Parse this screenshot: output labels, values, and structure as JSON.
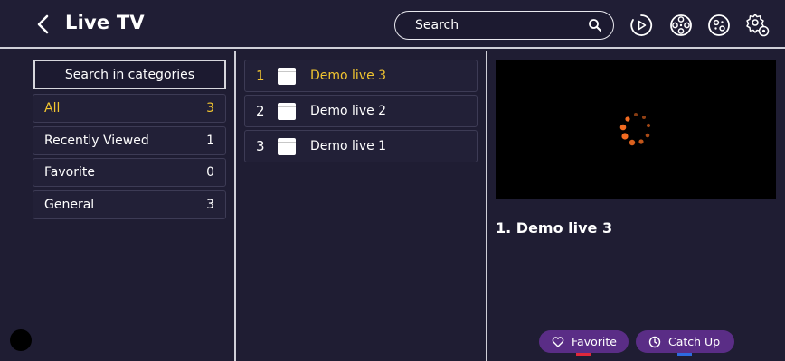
{
  "header": {
    "title": "Live TV",
    "search_placeholder": "Search",
    "icons": [
      "back-arrow-icon",
      "search-icon",
      "play-circle-icon",
      "film-reel-icon",
      "gamepad-icon",
      "settings-icon"
    ]
  },
  "categories": {
    "search_label": "Search in categories",
    "items": [
      {
        "label": "All",
        "count": "3",
        "active": true
      },
      {
        "label": "Recently Viewed",
        "count": "1",
        "active": false
      },
      {
        "label": "Favorite",
        "count": "0",
        "active": false
      },
      {
        "label": "General",
        "count": "3",
        "active": false
      }
    ]
  },
  "channels": [
    {
      "num": "1",
      "name": "Demo live 3",
      "active": true
    },
    {
      "num": "2",
      "name": "Demo live 2",
      "active": false
    },
    {
      "num": "3",
      "name": "Demo live 1",
      "active": false
    }
  ],
  "player": {
    "now_playing": "1.  Demo live 3",
    "favorite_label": "Favorite",
    "catchup_label": "Catch Up"
  },
  "colors": {
    "background": "#1f1d33",
    "accent_active": "#f2c530",
    "pill": "#5a2d86",
    "spinner": "#f26b21"
  }
}
